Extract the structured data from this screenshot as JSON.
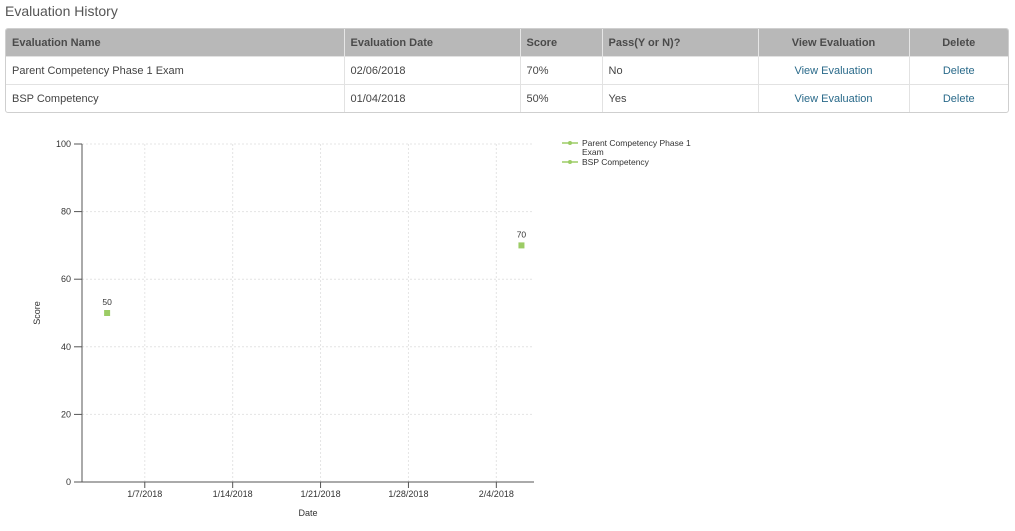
{
  "section_title": "Evaluation History",
  "table": {
    "columns": [
      "Evaluation Name",
      "Evaluation Date",
      "Score",
      "Pass(Y or N)?",
      "View Evaluation",
      "Delete"
    ],
    "rows": [
      {
        "name": "Parent Competency Phase 1 Exam",
        "date": "02/06/2018",
        "score": "70%",
        "pass": "No",
        "view": "View Evaluation",
        "delete": "Delete"
      },
      {
        "name": "BSP Competency",
        "date": "01/04/2018",
        "score": "50%",
        "pass": "Yes",
        "view": "View Evaluation",
        "delete": "Delete"
      }
    ]
  },
  "chart_data": {
    "type": "scatter",
    "xlabel": "Date",
    "ylabel": "Score",
    "ylim": [
      0,
      100
    ],
    "xlim": [
      "2018-01-02",
      "2018-02-07"
    ],
    "yticks": [
      0,
      20,
      40,
      60,
      80,
      100
    ],
    "xticks": [
      {
        "date": "2018-01-07",
        "label": "1/7/2018"
      },
      {
        "date": "2018-01-14",
        "label": "1/14/2018"
      },
      {
        "date": "2018-01-21",
        "label": "1/21/2018"
      },
      {
        "date": "2018-01-28",
        "label": "1/28/2018"
      },
      {
        "date": "2018-02-04",
        "label": "2/4/2018"
      }
    ],
    "grid": true,
    "legend": "top-right",
    "series": [
      {
        "name": "Parent Competency Phase 1 Exam",
        "legend_lines": [
          "Parent Competency Phase 1",
          "Exam"
        ],
        "color": "#9ccc65",
        "points": [
          {
            "x": "2018-02-06",
            "y": 70,
            "label": "70"
          }
        ]
      },
      {
        "name": "BSP Competency",
        "legend_lines": [
          "BSP Competency"
        ],
        "color": "#9ccc65",
        "points": [
          {
            "x": "2018-01-04",
            "y": 50,
            "label": "50"
          }
        ]
      }
    ]
  }
}
